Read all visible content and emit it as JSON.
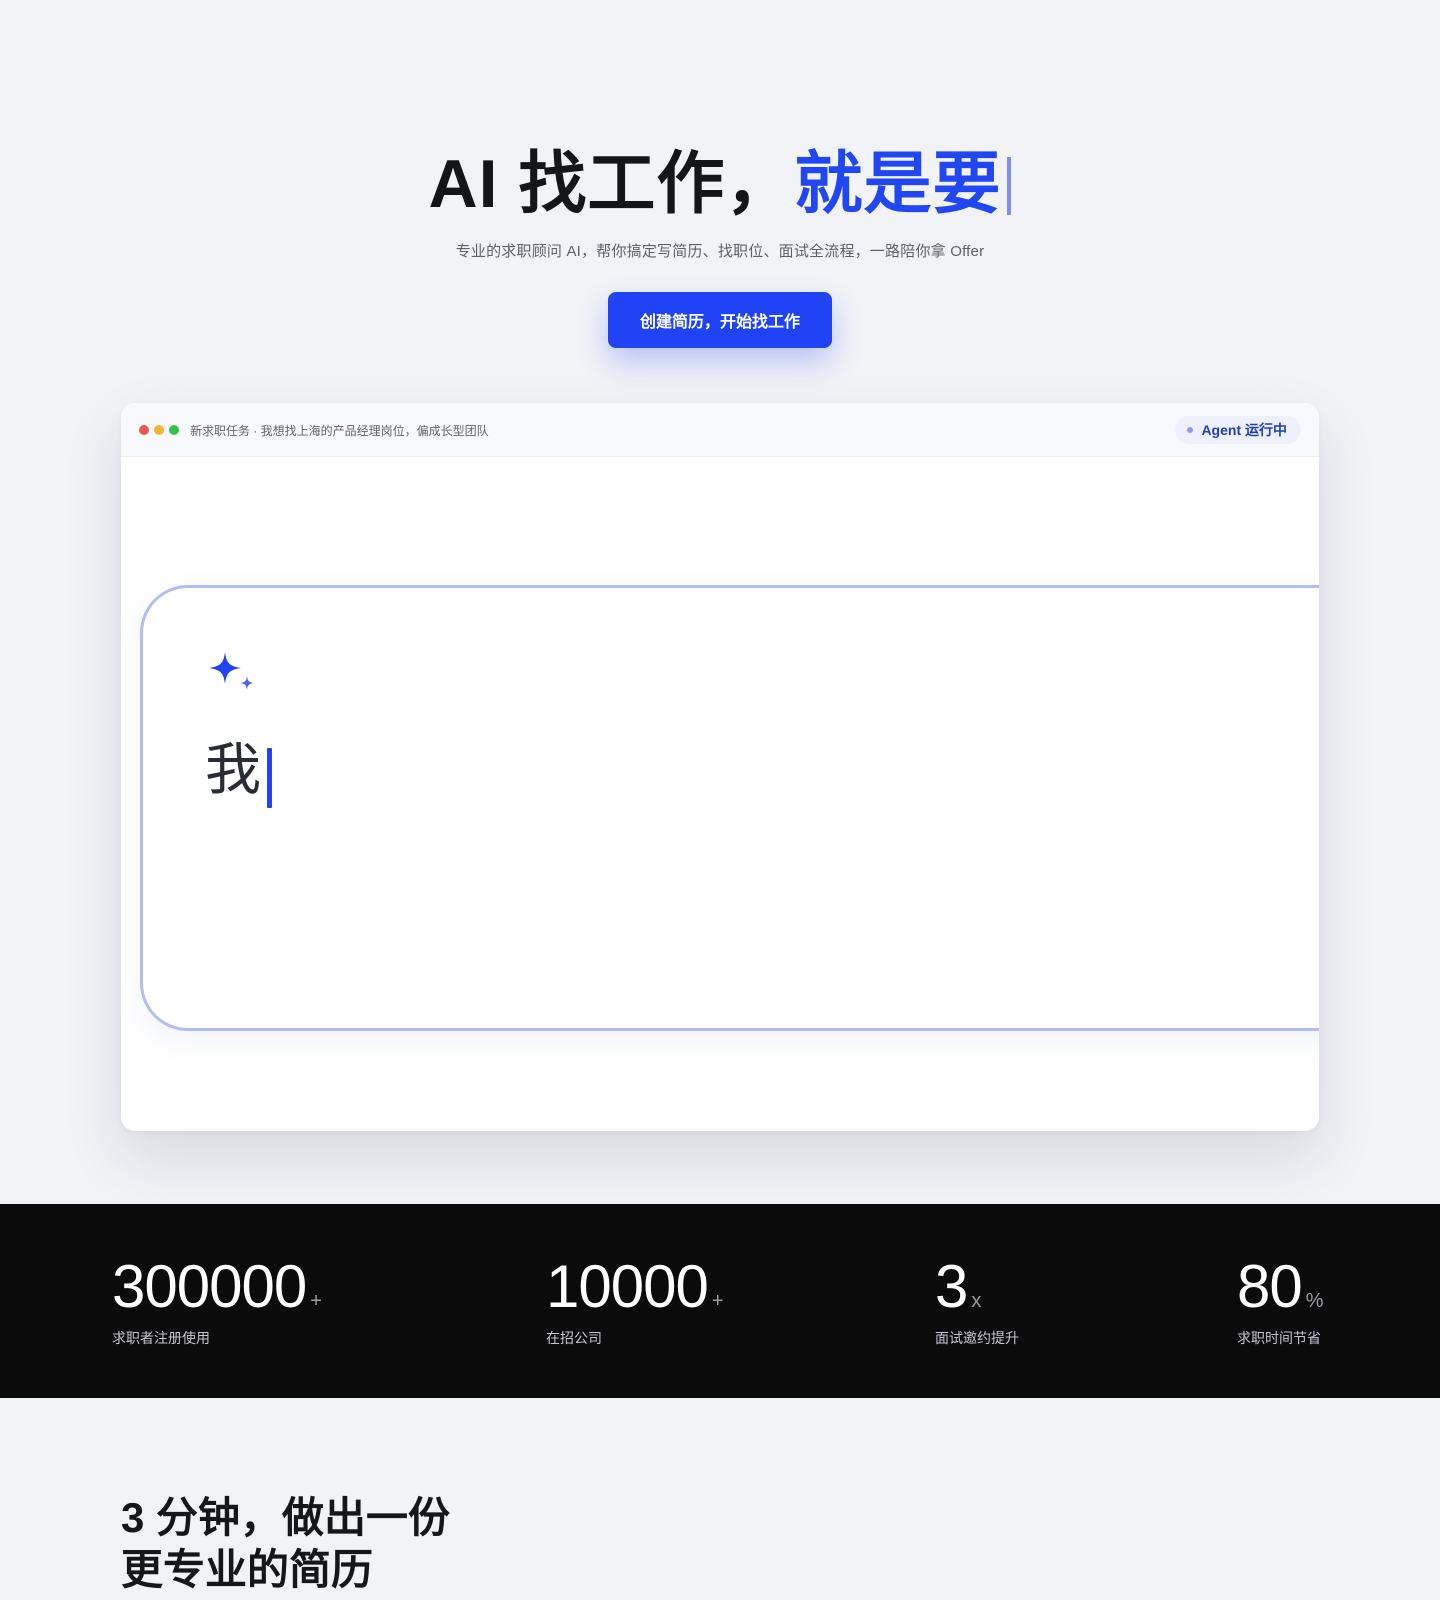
{
  "hero": {
    "title_dark": "AI 找工作，",
    "title_accent": "就是要",
    "subtitle": "专业的求职顾问 AI，帮你搞定写简历、找职位、面试全流程，一路陪你拿 Offer",
    "cta_label": "创建简历，开始找工作",
    "accent_color": "#2147f5"
  },
  "agent_window": {
    "title": "新求职任务 · 我想找上海的产品经理岗位，偏成长型团队",
    "status": "Agent 运行中",
    "composer_text": "我",
    "sparkle_icon": "sparkle-icon"
  },
  "stats": [
    {
      "value": "300000",
      "unit": "+",
      "label": "求职者注册使用"
    },
    {
      "value": "10000",
      "unit": "+",
      "label": "在招公司"
    },
    {
      "value": "3",
      "unit": "x",
      "label": "面试邀约提升"
    },
    {
      "value": "80",
      "unit": "%",
      "label": "求职时间节省"
    }
  ],
  "section": {
    "heading_line1": "3 分钟，做出一份",
    "heading_line2": "更专业的简历"
  }
}
